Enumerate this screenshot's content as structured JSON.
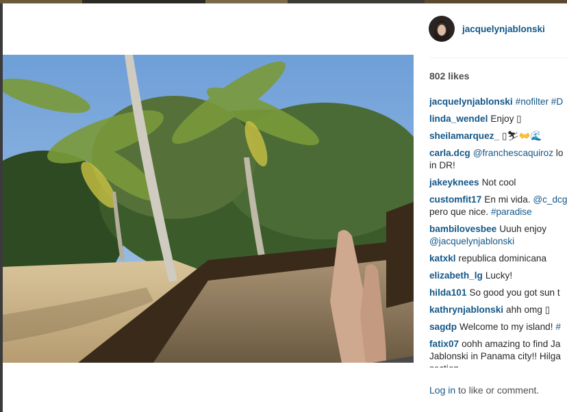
{
  "post": {
    "username": "jacquelynjablonski",
    "likes": "802 likes",
    "comments": [
      {
        "user": "jacquelynjablonski",
        "text": "",
        "tags": [
          "#nofilter",
          "#D"
        ]
      },
      {
        "user": "linda_wendel",
        "text": "Enjoy ▯"
      },
      {
        "user": "sheilamarquez_",
        "text": "▯⛷👐🌊"
      },
      {
        "user": "carla.dcg",
        "text": "",
        "tags": [
          "@franchescaquiroz"
        ],
        "after": " lo",
        "line2": "in DR!"
      },
      {
        "user": "jakeyknees",
        "text": "Not cool"
      },
      {
        "user": "customfit17",
        "text": "En mi vida.",
        "tags": [
          "@c_dcg"
        ],
        "line2": "pero que nice.",
        "tag2": "#paradise"
      },
      {
        "user": "bambilovesbee",
        "text": "Uuuh enjoy",
        "line2tag": "@jacquelynjablonski"
      },
      {
        "user": "katxkl",
        "text": "republica dominicana"
      },
      {
        "user": "elizabeth_lg",
        "text": "Lucky!"
      },
      {
        "user": "hilda101",
        "text": "So good you got sun t"
      },
      {
        "user": "kathrynjablonski",
        "text": "ahh omg ▯"
      },
      {
        "user": "sagdp",
        "text": "Welcome to my island!",
        "tags": [
          "#"
        ]
      },
      {
        "user": "fatix07",
        "text": "oohh amazing to find Ja",
        "line2": "Jablonski in Panama city!! Hilga",
        "line3": "section"
      }
    ],
    "login_link": "Log in",
    "login_suffix": " to like or comment."
  },
  "colors": {
    "link": "#125688",
    "text": "#262626",
    "muted": "#4d4d4d",
    "backdrop": "#3b3b3b"
  }
}
